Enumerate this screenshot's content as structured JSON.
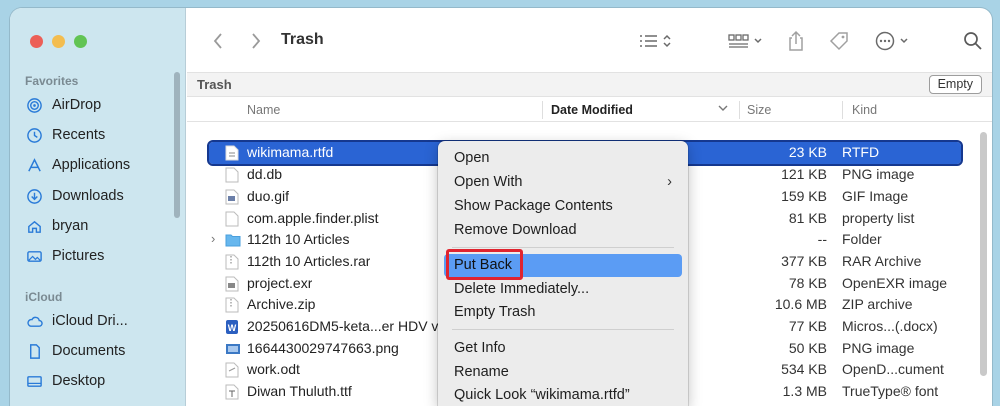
{
  "window": {
    "title": "Trash",
    "path_label": "Trash",
    "empty_button": "Empty"
  },
  "sidebar": {
    "favorites_header": "Favorites",
    "icloud_header": "iCloud",
    "favorites": [
      {
        "label": "AirDrop",
        "icon": "airdrop-icon"
      },
      {
        "label": "Recents",
        "icon": "clock-icon"
      },
      {
        "label": "Applications",
        "icon": "applications-icon"
      },
      {
        "label": "Downloads",
        "icon": "download-icon"
      },
      {
        "label": "bryan",
        "icon": "home-icon"
      },
      {
        "label": "Pictures",
        "icon": "photo-icon"
      }
    ],
    "icloud": [
      {
        "label": "iCloud Dri...",
        "icon": "cloud-icon"
      },
      {
        "label": "Documents",
        "icon": "document-icon"
      },
      {
        "label": "Desktop",
        "icon": "desktop-icon"
      }
    ]
  },
  "columns": {
    "name": "Name",
    "date": "Date Modified",
    "size": "Size",
    "kind": "Kind"
  },
  "files": [
    {
      "name": "wikimama.rtfd",
      "size": "23 KB",
      "kind": "RTFD",
      "selected": true
    },
    {
      "name": "dd.db",
      "size": "121 KB",
      "kind": "PNG image"
    },
    {
      "name": "duo.gif",
      "size": "159 KB",
      "kind": "GIF Image"
    },
    {
      "name": "com.apple.finder.plist",
      "size": "81 KB",
      "kind": "property list"
    },
    {
      "name": "112th 10 Articles",
      "size": "--",
      "kind": "Folder",
      "folder": true
    },
    {
      "name": "112th 10 Articles.rar",
      "size": "377 KB",
      "kind": "RAR Archive"
    },
    {
      "name": "project.exr",
      "size": "78 KB",
      "kind": "OpenEXR image"
    },
    {
      "name": "Archive.zip",
      "size": "10.6 MB",
      "kind": "ZIP archive"
    },
    {
      "name": "20250616DM5-keta...er HDV v",
      "size": "77 KB",
      "kind": "Micros...(.docx)"
    },
    {
      "name": "1664430029747663.png",
      "size": "50 KB",
      "kind": "PNG image"
    },
    {
      "name": "work.odt",
      "size": "534 KB",
      "kind": "OpenD...cument"
    },
    {
      "name": "Diwan Thuluth.ttf",
      "size": "1.3 MB",
      "kind": "TrueType® font"
    }
  ],
  "context_menu": {
    "open": "Open",
    "open_with": "Open With",
    "show_package": "Show Package Contents",
    "remove_download": "Remove Download",
    "put_back": "Put Back",
    "delete_immediately": "Delete Immediately...",
    "empty_trash": "Empty Trash",
    "get_info": "Get Info",
    "rename": "Rename",
    "quick_look": "Quick Look “wikimama.rtfd”"
  },
  "colors": {
    "selection": "#2a64d4",
    "menu_highlight": "#5b9cf4",
    "annotation": "#e0242f"
  }
}
